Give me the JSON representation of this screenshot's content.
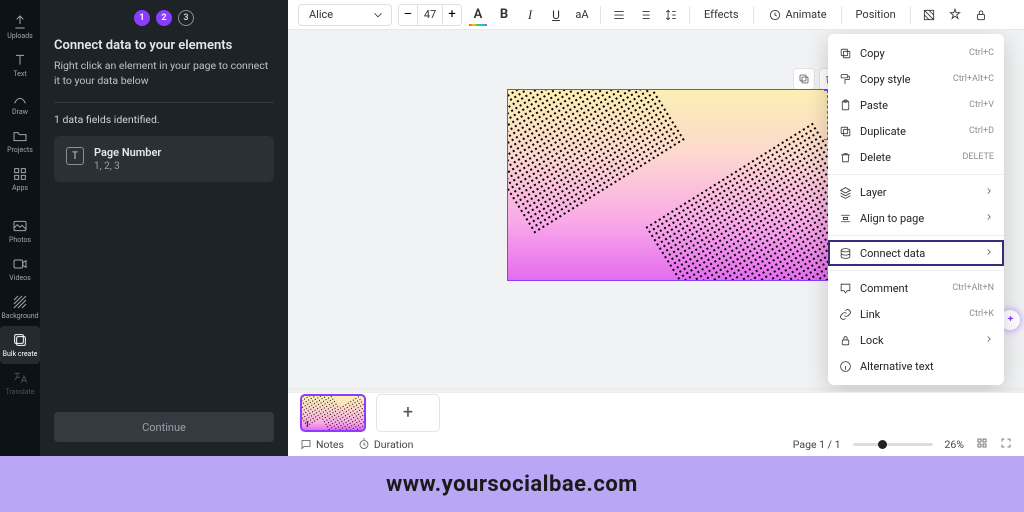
{
  "rail": {
    "items": [
      {
        "label": "Uploads"
      },
      {
        "label": "Text"
      },
      {
        "label": "Draw"
      },
      {
        "label": "Projects"
      },
      {
        "label": "Apps"
      },
      {
        "label": "Photos"
      },
      {
        "label": "Videos"
      },
      {
        "label": "Background"
      },
      {
        "label": "Bulk create"
      },
      {
        "label": "Translate"
      }
    ]
  },
  "panel": {
    "steps": [
      "1",
      "2",
      "3"
    ],
    "title": "Connect data to your elements",
    "desc": "Right click an element in your page to connect it to your data below",
    "identified": "1 data fields identified.",
    "field": {
      "icon": "T",
      "title": "Page Number",
      "values": "1, 2, 3"
    },
    "continue": "Continue"
  },
  "toolbar": {
    "font": "Alice",
    "size": "47",
    "minus": "–",
    "plus": "+",
    "color_glyph": "A",
    "bold": "B",
    "italic": "I",
    "underline": "U",
    "case": "aA",
    "effects": "Effects",
    "animate": "Animate",
    "position": "Position"
  },
  "ctx": {
    "items": [
      {
        "label": "Copy",
        "kbd": "Ctrl+C"
      },
      {
        "label": "Copy style",
        "kbd": "Ctrl+Alt+C"
      },
      {
        "label": "Paste",
        "kbd": "Ctrl+V"
      },
      {
        "label": "Duplicate",
        "kbd": "Ctrl+D"
      },
      {
        "label": "Delete",
        "kbd": "DELETE"
      }
    ],
    "items2": [
      {
        "label": "Layer"
      },
      {
        "label": "Align to page"
      }
    ],
    "connect": {
      "label": "Connect data"
    },
    "items3": [
      {
        "label": "Comment",
        "kbd": "Ctrl+Alt+N"
      },
      {
        "label": "Link",
        "kbd": "Ctrl+K"
      },
      {
        "label": "Lock"
      },
      {
        "label": "Alternative text"
      }
    ]
  },
  "status": {
    "notes": "Notes",
    "duration": "Duration",
    "page": "Page 1 / 1",
    "zoom": "26%",
    "thumb_no": "1"
  },
  "banner": "www.yoursocialbae.com"
}
